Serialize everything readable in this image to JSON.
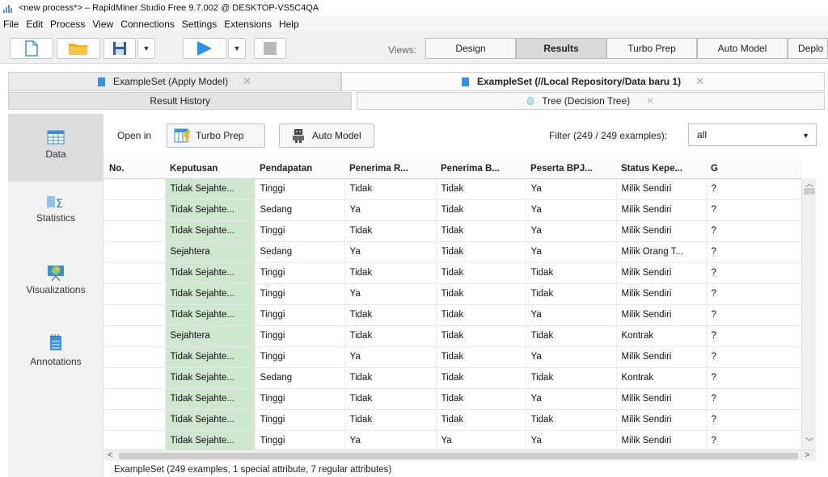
{
  "window": {
    "title": "<new process*> – RapidMiner Studio Free 9.7.002 @ DESKTOP-VS5C4QA"
  },
  "menu": [
    "File",
    "Edit",
    "Process",
    "View",
    "Connections",
    "Settings",
    "Extensions",
    "Help"
  ],
  "toolbar": {
    "views_label": "Views:",
    "views": [
      "Design",
      "Results",
      "Turbo Prep",
      "Auto Model",
      "Deplo"
    ],
    "active_view": "Results"
  },
  "doc_tabs": [
    {
      "label": "ExampleSet (Apply Model)",
      "active": false
    },
    {
      "label": "ExampleSet (//Local Repository/Data baru 1)",
      "active": true
    }
  ],
  "sub_tabs": [
    {
      "label": "Result History"
    },
    {
      "label": "Tree (Decision Tree)"
    }
  ],
  "sidebar": [
    "Data",
    "Statistics",
    "Visualizations",
    "Annotations"
  ],
  "content": {
    "open_in_label": "Open in",
    "turbo_prep_label": "Turbo Prep",
    "auto_model_label": "Auto Model",
    "filter_label": "Filter (249 / 249 examples):",
    "filter_value": "all"
  },
  "table": {
    "columns": [
      "No.",
      "Keputusan",
      "Pendapatan",
      "Penerima R...",
      "Penerima B...",
      "Peserta BPJ...",
      "Status Kepe...",
      "G"
    ],
    "rows": [
      [
        "",
        "Tidak Sejahte...",
        "Tinggi",
        "Tidak",
        "Tidak",
        "Ya",
        "Milik Sendiri",
        "?"
      ],
      [
        "",
        "Tidak Sejahte...",
        "Sedang",
        "Ya",
        "Tidak",
        "Ya",
        "Milik Sendiri",
        "?"
      ],
      [
        "",
        "Tidak Sejahte...",
        "Tinggi",
        "Tidak",
        "Tidak",
        "Ya",
        "Milik Sendiri",
        "?"
      ],
      [
        "",
        "Sejahtera",
        "Sedang",
        "Ya",
        "Tidak",
        "Ya",
        "Milik Orang T...",
        "?"
      ],
      [
        "",
        "Tidak Sejahte...",
        "Tinggi",
        "Tidak",
        "Tidak",
        "Tidak",
        "Milik Sendiri",
        "?"
      ],
      [
        "",
        "Tidak Sejahte...",
        "Tinggi",
        "Ya",
        "Tidak",
        "Tidak",
        "Milik Sendiri",
        "?"
      ],
      [
        "",
        "Tidak Sejahte...",
        "Tinggi",
        "Tidak",
        "Tidak",
        "Ya",
        "Milik Sendiri",
        "?"
      ],
      [
        "",
        "Sejahtera",
        "Tinggi",
        "Tidak",
        "Tidak",
        "Tidak",
        "Kontrak",
        "?"
      ],
      [
        "",
        "Tidak Sejahte...",
        "Tinggi",
        "Ya",
        "Tidak",
        "Ya",
        "Milik Sendiri",
        "?"
      ],
      [
        "",
        "Tidak Sejahte...",
        "Sedang",
        "Tidak",
        "Tidak",
        "Tidak",
        "Kontrak",
        "?"
      ],
      [
        "",
        "Tidak Sejahte...",
        "Tinggi",
        "Tidak",
        "Tidak",
        "Ya",
        "Milik Sendiri",
        "?"
      ],
      [
        "",
        "Tidak Sejahte...",
        "Tinggi",
        "Tidak",
        "Tidak",
        "Tidak",
        "Milik Sendiri",
        "?"
      ],
      [
        "",
        "Tidak Sejahte...",
        "Tinggi",
        "Ya",
        "Ya",
        "Ya",
        "Milik Sendiri",
        "?"
      ]
    ]
  },
  "status": "ExampleSet (249 examples, 1 special attribute, 7 regular attributes)",
  "colors": {
    "label_column": "#cfe6cf",
    "accent_blue": "#3a8fd6",
    "run_blue": "#2e8fe0"
  }
}
